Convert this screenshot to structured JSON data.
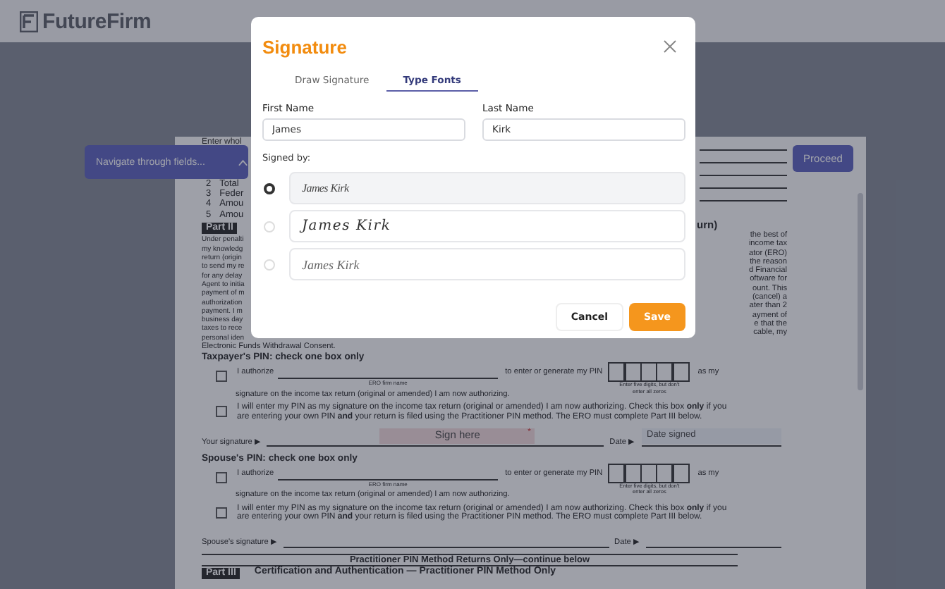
{
  "header": {
    "logo_text": "FutureFirm"
  },
  "navigator": {
    "label": "Navigate through fields..."
  },
  "proceed_button": "Proceed",
  "document": {
    "top_fragment": "Enter whol",
    "numbered_lines": [
      {
        "number": "2",
        "text": "Total"
      },
      {
        "number": "3",
        "text": "Feder"
      },
      {
        "number": "4",
        "text": "Amou"
      },
      {
        "number": "5",
        "text": "Amou"
      }
    ],
    "part_label": "Part II",
    "right_heading_fragment": "urn)",
    "left_fragments": [
      "Under penalti",
      "my knowledg",
      "return (origin",
      "to send my re",
      "for any delay",
      "Agent to initia",
      "payment of m",
      "authorization",
      "payment. I m",
      "business day",
      "taxes to rece",
      "personal iden"
    ],
    "right_fragments": [
      "the best of",
      "income tax",
      "ator (ERO)",
      "the reason",
      "d Financial",
      "oftware for",
      "ount. This",
      "(cancel) a",
      "ater than 2",
      "ayment of",
      "e that the",
      "cable, my"
    ],
    "consent_line": "Electronic Funds Withdrawal Consent.",
    "pin_sections": [
      {
        "heading": "Taxpayer's PIN: check one box only",
        "authorize_checked": false,
        "authorize_lead": "I authorize",
        "firm_caption": "ERO firm name",
        "authorize_middle": "to enter or generate my PIN",
        "pin_hint": "Enter five digits, but don't enter all zeros",
        "authorize_tail": "as my",
        "continuation": "signature on the income tax return (original or amended) I am now authorizing.",
        "self_checked": false,
        "self_text": "I will enter my PIN as my signature on the income tax return (original or amended) I am now authorizing. Check this box **only** if you are entering your own PIN **and** your return is filed using the Practitioner PIN method. The ERO must complete Part III below.",
        "signature_label": "Your signature ▶",
        "signature_placeholder": "Sign here",
        "required_mark": "*",
        "date_label": "Date ▶",
        "date_placeholder": "Date signed"
      },
      {
        "heading": "Spouse's PIN: check one box only",
        "authorize_checked": false,
        "authorize_lead": "I authorize",
        "firm_caption": "ERO firm name",
        "authorize_middle": "to enter or generate my PIN",
        "pin_hint": "Enter five digits, but don't enter all zeros",
        "authorize_tail": "as my",
        "continuation": "signature on the income tax return (original or amended) I am now authorizing.",
        "self_checked": false,
        "self_text": "I will enter my PIN as my signature on the income tax return (original or amended) I am now authorizing. Check this box **only** if you are entering your own PIN **and** your return is filed using the Practitioner PIN method. The ERO must complete Part III below.",
        "signature_label": "Spouse's signature ▶",
        "date_label": "Date ▶"
      }
    ],
    "continue_banner": "Practitioner PIN Method Returns Only—continue below",
    "part3": {
      "label": "Part III",
      "title": "Certification and Authentication — Practitioner PIN Method Only"
    }
  },
  "dialog": {
    "title": "Signature",
    "tabs": [
      {
        "label": "Draw Signature",
        "selected": false
      },
      {
        "label": "Type Fonts",
        "selected": true
      }
    ],
    "first_name": {
      "label": "First Name",
      "value": "James"
    },
    "last_name": {
      "label": "Last Name",
      "value": "Kirk"
    },
    "signed_by_label": "Signed by:",
    "signature_options": [
      {
        "text": "James Kirk",
        "kind": "compact",
        "selected": true
      },
      {
        "text": "James Kirk",
        "kind": "flowing",
        "selected": false
      },
      {
        "text": "James Kirk",
        "kind": "thin",
        "selected": false
      }
    ],
    "buttons": {
      "cancel": "Cancel",
      "save": "Save"
    }
  }
}
